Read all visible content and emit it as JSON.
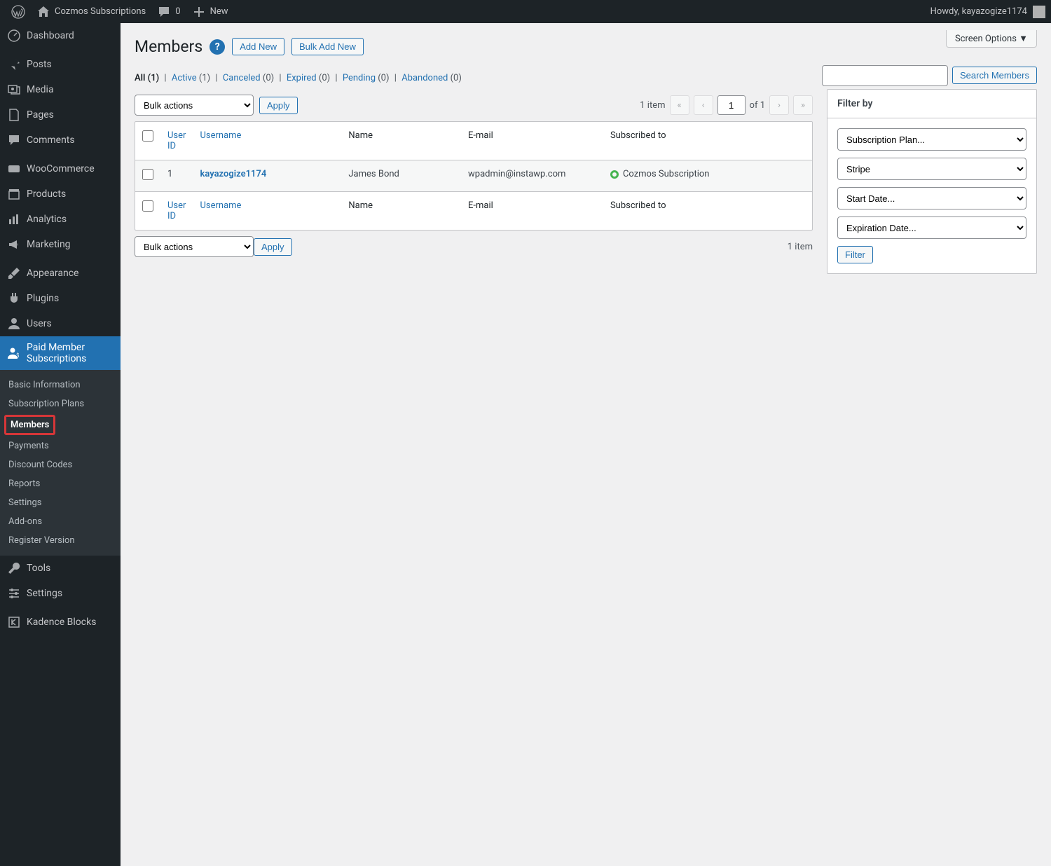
{
  "adminbar": {
    "site_name": "Cozmos Subscriptions",
    "comments_count": "0",
    "new_label": "New",
    "howdy": "Howdy, kayazogize1174"
  },
  "sidebar": {
    "dashboard": "Dashboard",
    "posts": "Posts",
    "media": "Media",
    "pages": "Pages",
    "comments": "Comments",
    "woocommerce": "WooCommerce",
    "products": "Products",
    "analytics": "Analytics",
    "marketing": "Marketing",
    "appearance": "Appearance",
    "plugins": "Plugins",
    "users": "Users",
    "pms": "Paid Member Subscriptions",
    "tools": "Tools",
    "settings": "Settings",
    "kadence": "Kadence Blocks"
  },
  "submenu": {
    "basic": "Basic Information",
    "plans": "Subscription Plans",
    "members": "Members",
    "payments": "Payments",
    "discount": "Discount Codes",
    "reports": "Reports",
    "settings": "Settings",
    "addons": "Add-ons",
    "register": "Register Version"
  },
  "page": {
    "title": "Members",
    "add_new": "Add New",
    "bulk_add_new": "Bulk Add New",
    "screen_options": "Screen Options ▼",
    "search_btn": "Search Members",
    "bulk_actions": "Bulk actions",
    "apply": "Apply",
    "filter_title": "Filter by",
    "filter_btn": "Filter",
    "item_count_top": "1 item",
    "item_count_bottom": "1 item",
    "page_current": "1",
    "page_of": "of 1"
  },
  "filters": {
    "all_label": "All",
    "all_count": "(1)",
    "active_label": "Active",
    "active_count": "(1)",
    "canceled_label": "Canceled",
    "canceled_count": "(0)",
    "expired_label": "Expired",
    "expired_count": "(0)",
    "pending_label": "Pending",
    "pending_count": "(0)",
    "abandoned_label": "Abandoned",
    "abandoned_count": "(0)"
  },
  "columns": {
    "user_id": "User ID",
    "username": "Username",
    "name": "Name",
    "email": "E-mail",
    "subscribed_to": "Subscribed to"
  },
  "row": {
    "id": "1",
    "username": "kayazogize1174",
    "name": "James Bond",
    "email": "wpadmin@instawp.com",
    "plan": "Cozmos Subscription"
  },
  "filterbox": {
    "plan": "Subscription Plan...",
    "gateway": "Stripe",
    "start": "Start Date...",
    "exp": "Expiration Date..."
  }
}
